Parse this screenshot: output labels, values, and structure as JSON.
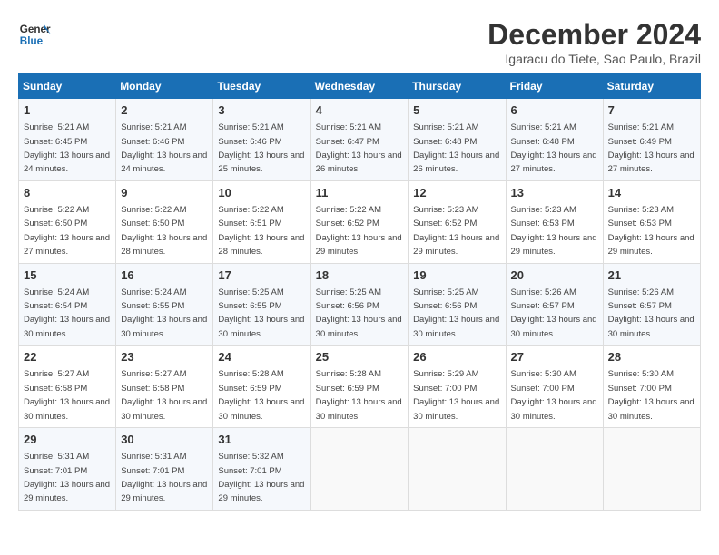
{
  "logo": {
    "line1": "General",
    "line2": "Blue"
  },
  "title": "December 2024",
  "subtitle": "Igaracu do Tiete, Sao Paulo, Brazil",
  "days_header": [
    "Sunday",
    "Monday",
    "Tuesday",
    "Wednesday",
    "Thursday",
    "Friday",
    "Saturday"
  ],
  "weeks": [
    [
      {
        "day": "1",
        "rise": "5:21 AM",
        "set": "6:45 PM",
        "daylight": "13 hours and 24 minutes."
      },
      {
        "day": "2",
        "rise": "5:21 AM",
        "set": "6:46 PM",
        "daylight": "13 hours and 24 minutes."
      },
      {
        "day": "3",
        "rise": "5:21 AM",
        "set": "6:46 PM",
        "daylight": "13 hours and 25 minutes."
      },
      {
        "day": "4",
        "rise": "5:21 AM",
        "set": "6:47 PM",
        "daylight": "13 hours and 26 minutes."
      },
      {
        "day": "5",
        "rise": "5:21 AM",
        "set": "6:48 PM",
        "daylight": "13 hours and 26 minutes."
      },
      {
        "day": "6",
        "rise": "5:21 AM",
        "set": "6:48 PM",
        "daylight": "13 hours and 27 minutes."
      },
      {
        "day": "7",
        "rise": "5:21 AM",
        "set": "6:49 PM",
        "daylight": "13 hours and 27 minutes."
      }
    ],
    [
      {
        "day": "8",
        "rise": "5:22 AM",
        "set": "6:50 PM",
        "daylight": "13 hours and 27 minutes."
      },
      {
        "day": "9",
        "rise": "5:22 AM",
        "set": "6:50 PM",
        "daylight": "13 hours and 28 minutes."
      },
      {
        "day": "10",
        "rise": "5:22 AM",
        "set": "6:51 PM",
        "daylight": "13 hours and 28 minutes."
      },
      {
        "day": "11",
        "rise": "5:22 AM",
        "set": "6:52 PM",
        "daylight": "13 hours and 29 minutes."
      },
      {
        "day": "12",
        "rise": "5:23 AM",
        "set": "6:52 PM",
        "daylight": "13 hours and 29 minutes."
      },
      {
        "day": "13",
        "rise": "5:23 AM",
        "set": "6:53 PM",
        "daylight": "13 hours and 29 minutes."
      },
      {
        "day": "14",
        "rise": "5:23 AM",
        "set": "6:53 PM",
        "daylight": "13 hours and 29 minutes."
      }
    ],
    [
      {
        "day": "15",
        "rise": "5:24 AM",
        "set": "6:54 PM",
        "daylight": "13 hours and 30 minutes."
      },
      {
        "day": "16",
        "rise": "5:24 AM",
        "set": "6:55 PM",
        "daylight": "13 hours and 30 minutes."
      },
      {
        "day": "17",
        "rise": "5:25 AM",
        "set": "6:55 PM",
        "daylight": "13 hours and 30 minutes."
      },
      {
        "day": "18",
        "rise": "5:25 AM",
        "set": "6:56 PM",
        "daylight": "13 hours and 30 minutes."
      },
      {
        "day": "19",
        "rise": "5:25 AM",
        "set": "6:56 PM",
        "daylight": "13 hours and 30 minutes."
      },
      {
        "day": "20",
        "rise": "5:26 AM",
        "set": "6:57 PM",
        "daylight": "13 hours and 30 minutes."
      },
      {
        "day": "21",
        "rise": "5:26 AM",
        "set": "6:57 PM",
        "daylight": "13 hours and 30 minutes."
      }
    ],
    [
      {
        "day": "22",
        "rise": "5:27 AM",
        "set": "6:58 PM",
        "daylight": "13 hours and 30 minutes."
      },
      {
        "day": "23",
        "rise": "5:27 AM",
        "set": "6:58 PM",
        "daylight": "13 hours and 30 minutes."
      },
      {
        "day": "24",
        "rise": "5:28 AM",
        "set": "6:59 PM",
        "daylight": "13 hours and 30 minutes."
      },
      {
        "day": "25",
        "rise": "5:28 AM",
        "set": "6:59 PM",
        "daylight": "13 hours and 30 minutes."
      },
      {
        "day": "26",
        "rise": "5:29 AM",
        "set": "7:00 PM",
        "daylight": "13 hours and 30 minutes."
      },
      {
        "day": "27",
        "rise": "5:30 AM",
        "set": "7:00 PM",
        "daylight": "13 hours and 30 minutes."
      },
      {
        "day": "28",
        "rise": "5:30 AM",
        "set": "7:00 PM",
        "daylight": "13 hours and 30 minutes."
      }
    ],
    [
      {
        "day": "29",
        "rise": "5:31 AM",
        "set": "7:01 PM",
        "daylight": "13 hours and 29 minutes."
      },
      {
        "day": "30",
        "rise": "5:31 AM",
        "set": "7:01 PM",
        "daylight": "13 hours and 29 minutes."
      },
      {
        "day": "31",
        "rise": "5:32 AM",
        "set": "7:01 PM",
        "daylight": "13 hours and 29 minutes."
      },
      null,
      null,
      null,
      null
    ]
  ],
  "labels": {
    "sunrise": "Sunrise:",
    "sunset": "Sunset:",
    "daylight": "Daylight:"
  }
}
